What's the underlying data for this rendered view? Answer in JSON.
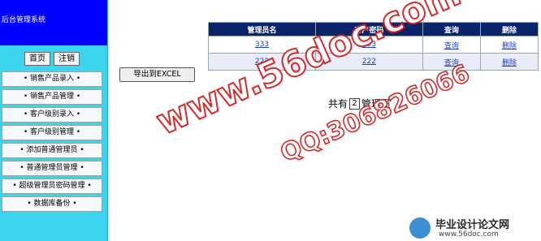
{
  "sidebar": {
    "title": "后台管理系统",
    "buttons": [
      "首页",
      "注销"
    ],
    "menu": [
      "• 销售产品录入 •",
      "• 销售产品管理 •",
      "• 客户级别录入 •",
      "• 客户级别管理 •",
      "• 添加普通管理员 •",
      "• 普通管理员管理 •",
      "• 超级管理员密码管理 •",
      "• 数据库备份 •"
    ]
  },
  "main": {
    "export_label": "导出到EXCEL",
    "table": {
      "headers": [
        "管理员名",
        "客户密码",
        "查询",
        "删除"
      ],
      "rows": [
        [
          "333",
          "333",
          "查询",
          "删除"
        ],
        [
          "222",
          "222",
          "查询",
          "删除"
        ]
      ]
    },
    "summary": {
      "prefix": "共有",
      "count": "2",
      "suffix": "管理员"
    }
  },
  "watermark": {
    "site": "www.56doc.com",
    "qq": "QQ:306826066"
  },
  "logo": {
    "name": "毕业设计论文网",
    "url": "www.56doc.com"
  }
}
